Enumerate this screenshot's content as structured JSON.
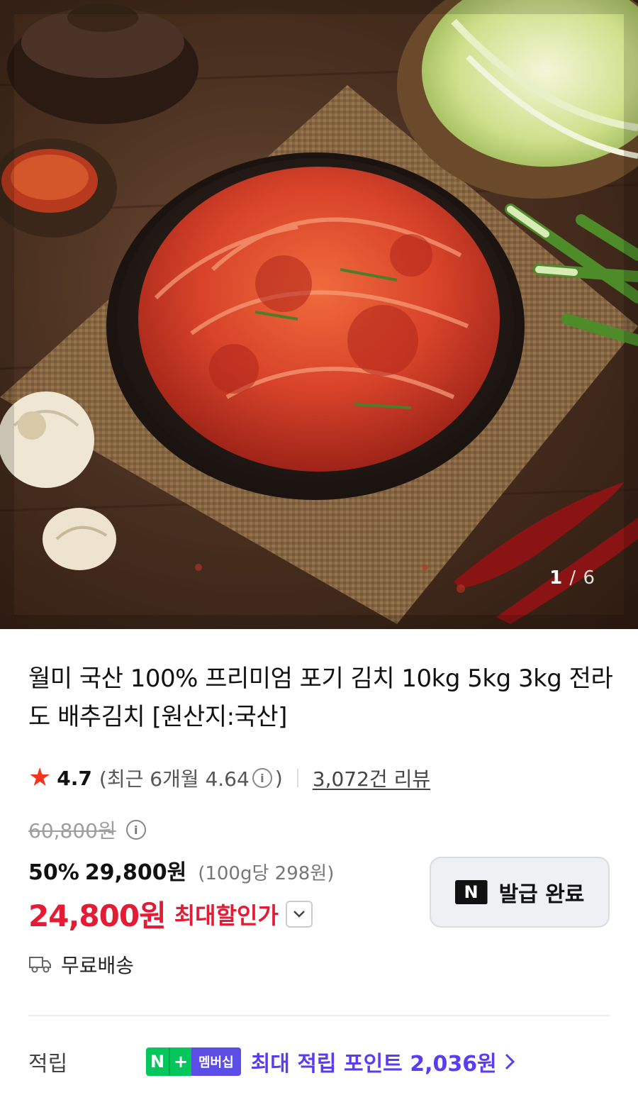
{
  "gallery": {
    "current": "1",
    "separator": "/",
    "total": "6"
  },
  "product": {
    "title": "월미 국산 100% 프리미엄 포기 김치 10kg 5kg 3kg 전라도 배추김치 [원산지:국산]"
  },
  "rating": {
    "star_icon": "star-icon",
    "value": "4.7",
    "recent_prefix": "(최근 6개월 4.64",
    "recent_suffix": ")",
    "reviews": "3,072건 리뷰"
  },
  "price": {
    "original": "60,800원",
    "discount": "50%",
    "sale": "29,800원",
    "unit": "(100g당 298원)",
    "final": "24,800원",
    "final_label": "최대할인가"
  },
  "coupon": {
    "badge": "N",
    "label": "발급 완료"
  },
  "shipping": {
    "label": "무료배송"
  },
  "points": {
    "label": "적립",
    "badge_n": "N",
    "badge_plus": "+",
    "badge_text": "멤버십",
    "text": "최대 적립 포인트 2,036원"
  },
  "colors": {
    "accent_red": "#e31b35",
    "star": "#f1361d",
    "points_purple": "#5b3df0",
    "naver_green": "#03c75a"
  }
}
